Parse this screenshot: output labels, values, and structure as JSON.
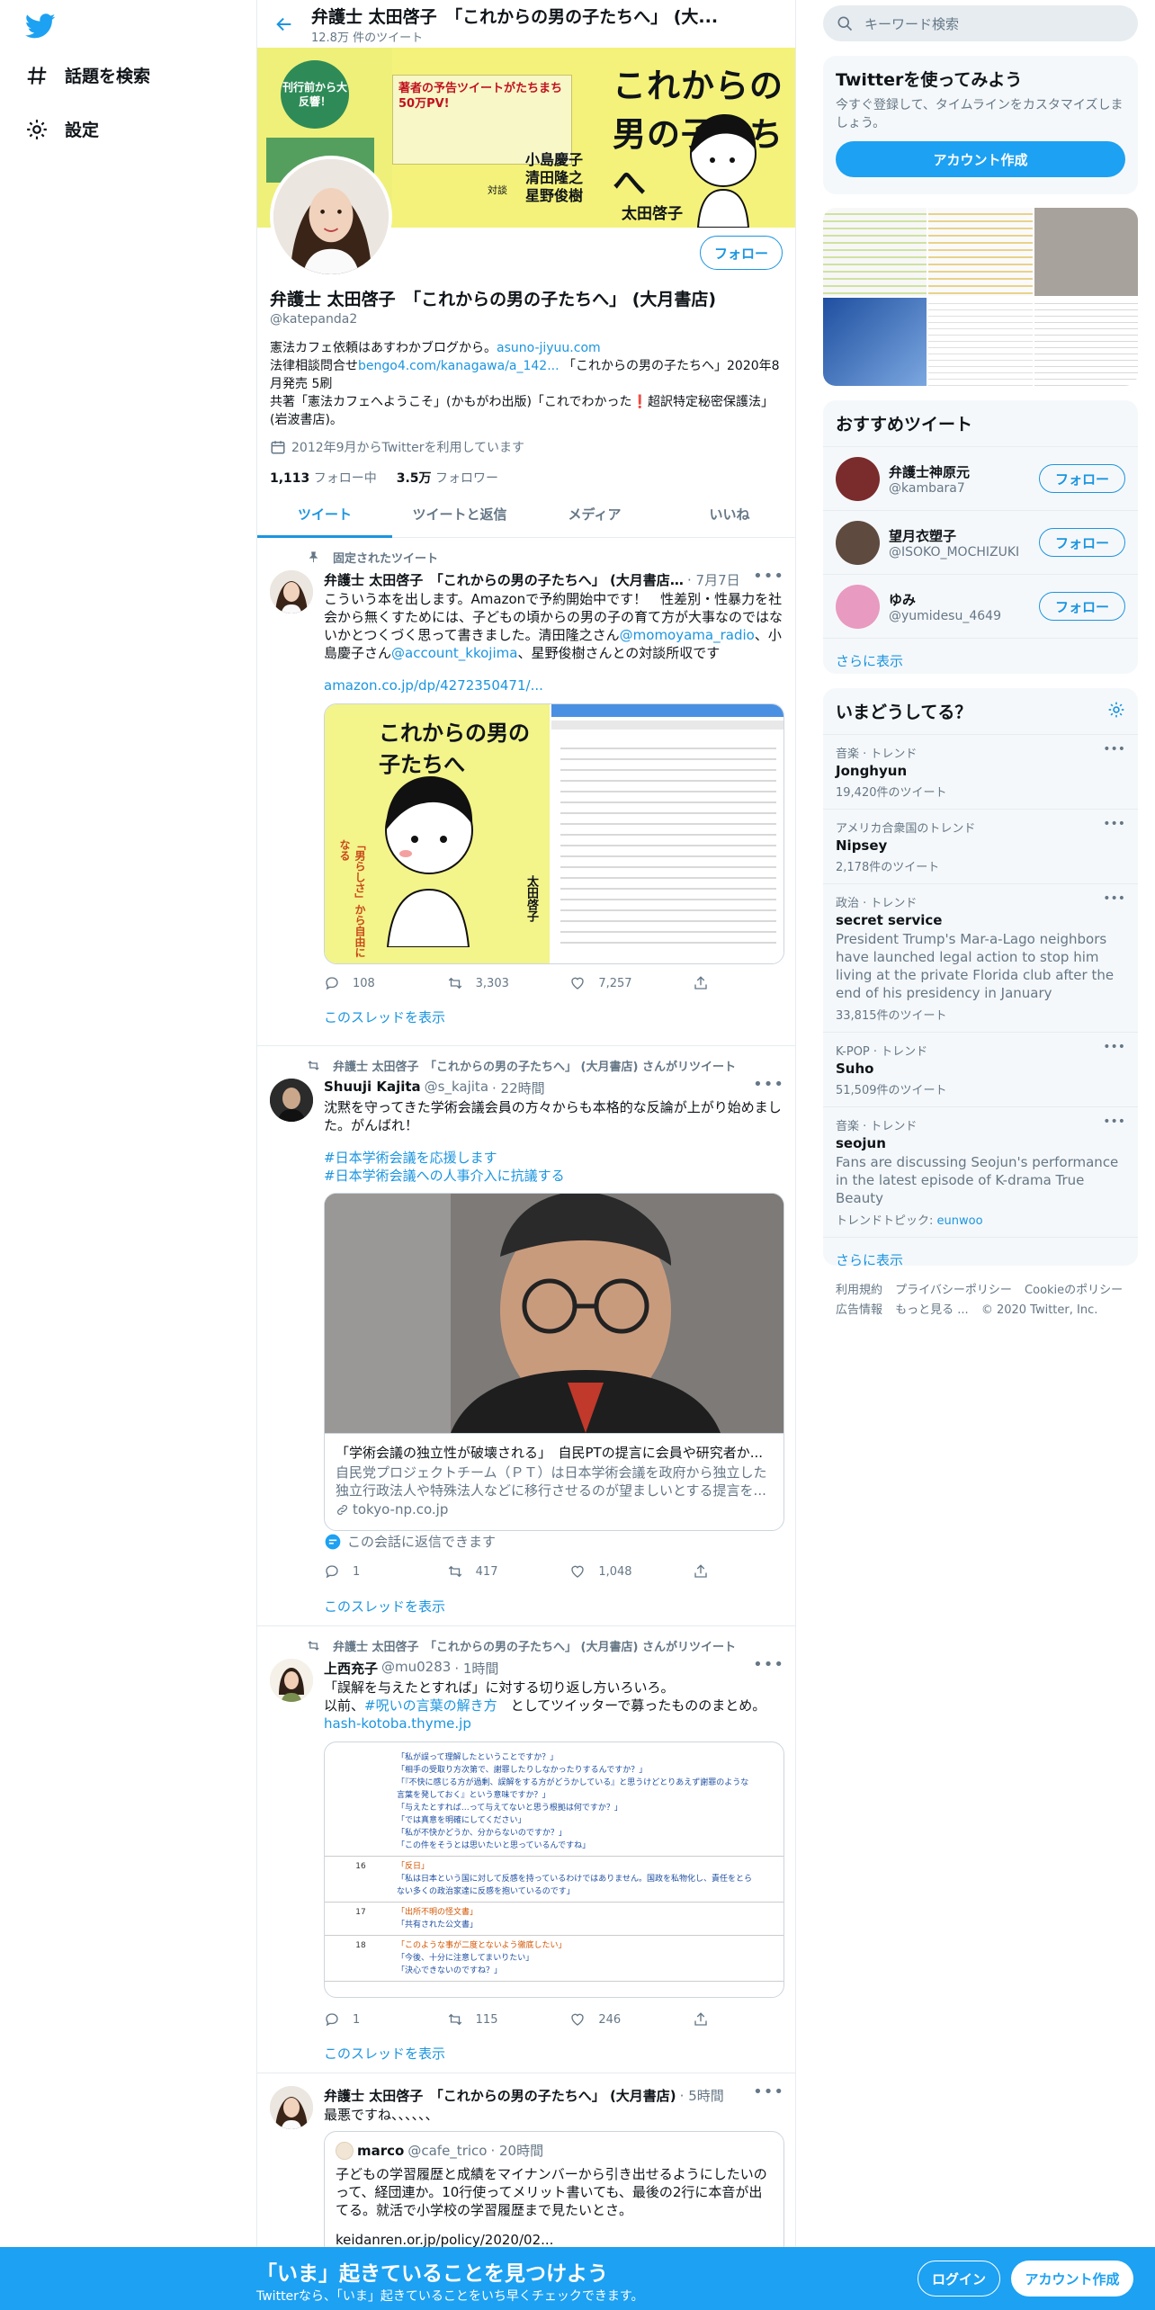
{
  "nav": {
    "explore_label": "話題を検索",
    "settings_label": "設定"
  },
  "header": {
    "name": "弁護士 太田啓子　「これからの男の子たちへ」 (大...",
    "tweet_count": "12.8万 件のツイート"
  },
  "banner": {
    "title": "これからの男の子たちへ",
    "badge": "刊行前から大反響！",
    "book_ad": "著者の予告ツイートがたちまち50万PV!",
    "author": "太田啓子",
    "guests": [
      "小島慶子",
      "清田隆之",
      "星野俊樹"
    ],
    "guests_label": "対談"
  },
  "profile": {
    "name": "弁護士 太田啓子　「これからの男の子たちへ」 (大月書店)",
    "handle": "@katepanda2",
    "follow_label": "フォロー",
    "bio_line1": "憲法カフェ依頼はあすわかブログから。",
    "bio_link1": "asuno-jiyuu.com",
    "bio_line2": "法律相談問合せ",
    "bio_link2": "bengo4.com/kanagawa/a_142...",
    "bio_line2b": " 「これからの男の子たちへ」2020年8月発売 5刷",
    "bio_line3": "共著「憲法カフェへようこそ」(かもがわ出版)「これでわかった",
    "bio_exclaim": "❗",
    "bio_line3b": "超訳特定秘密保護法」(岩波書店)。",
    "joined": "2012年9月からTwitterを利用しています",
    "following_count": "1,113",
    "following_label": "フォロー中",
    "followers_count": "3.5万",
    "followers_label": "フォロワー"
  },
  "tabs": [
    "ツイート",
    "ツイートと返信",
    "メディア",
    "いいね"
  ],
  "tweets": [
    {
      "meta": "固定されたツイート",
      "name": "弁護士 太田啓子　「これからの男の子たちへ」 (大月書店...",
      "time": "· 7月7日",
      "text_a": "こういう本を出します。Amazonで予約開始中です！　性差別・性暴力を社会から無くすためには、子どもの頃からの男の子の育て方が大事なのではないかとつくづく思って書きました。清田隆之さん",
      "mention1": "@momoyama_radio",
      "text_b": "、小島慶子さん",
      "mention2": "@account_kkojima",
      "text_c": "、星野俊樹さんとの対談所収です",
      "link": "amazon.co.jp/dp/4272350471/...",
      "cover_title": "これからの男の子たちへ",
      "cover_sub": "「男らしさ」から自由になる",
      "cover_author": "太田啓子",
      "replies": "108",
      "retweets": "3,303",
      "likes": "7,257",
      "show_thread": "このスレッドを表示"
    },
    {
      "meta": "弁護士 太田啓子　「これからの男の子たちへ」 (大月書店) さんがリツイート",
      "name": "Shuuji Kajita",
      "handle": "@s_kajita",
      "time": "· 22時間",
      "text": "沈黙を守ってきた学術会議会員の方々からも本格的な反論が上がり始めました。がんばれ！",
      "hashtag1": "#日本学術会議を応援します",
      "hashtag2": "#日本学術会議への人事介入に抗議する",
      "card_title": "「学術会議の独立性が破壊される」　自民PTの提言に会員や研究者か...",
      "card_desc": "自民党プロジェクトチーム（ＰＴ）は日本学術会議を政府から独立した独立行政法人や特殊法人などに移行させるのが望ましいとする提言を...",
      "card_domain": "tokyo-np.co.jp",
      "reply_note": "この会話に返信できます",
      "replies": "1",
      "retweets": "417",
      "likes": "1,048",
      "show_thread": "このスレッドを表示"
    },
    {
      "meta": "弁護士 太田啓子　「これからの男の子たちへ」 (大月書店) さんがリツイート",
      "name": "上西充子",
      "handle": "@mu0283",
      "time": "· 1時間",
      "text_a": "「誤解を与えたとすれば」に対する切り返し方いろいろ。",
      "text_b": "以前、",
      "hashtag": "#呪いの言葉の解き方",
      "text_c": "　としてツイッターで募ったもののまとめ。",
      "link": "hash-kotoba.thyme.jp",
      "replies": "1",
      "retweets": "115",
      "likes": "246",
      "show_thread": "このスレッドを表示"
    },
    {
      "name": "弁護士 太田啓子　「これからの男の子たちへ」 (大月書店)",
      "time": "· 5時間",
      "text": "最悪ですね、、、、、、",
      "quote_name": "marco",
      "quote_handle": "@cafe_trico",
      "quote_time": "· 20時間",
      "quote_text": "子どもの学習履歴と成績をマイナンバーから引き出せるようにしたいのって、経団連か。10行使ってメリット書いても、最後の2行に本音が出てる。就活で小学校の学習履歴まで見たいとさ。",
      "quote_link": "keidanren.or.jp/policy/2020/02..."
    }
  ],
  "screenshot_rows": [
    {
      "num": "",
      "lines": [
        "「私が誤って理解したということですか？」",
        "「相手の受取り方次第で、謝罪したりしなかったりするんですか？」",
        "「『不快に感じる方が過剰、誤解をする方がどうかしている』と思うけどとりあえず謝罪のような言葉を発しておく』という意味ですか？」",
        "「与えたとすれば…って与えてないと思う根拠は何ですか？」",
        "「では真意を明確にしてください」",
        "「私が不快かどうか、分からないのですか？」",
        "「この件をそうとは思いたいと思っているんですね」"
      ]
    },
    {
      "num": "16",
      "lines": [
        "「反日」",
        "「私は日本という国に対して反感を持っているわけではありません。国政を私物化し、責任をとらない多くの政治家達に反感を抱いているのです」"
      ]
    },
    {
      "num": "17",
      "lines": [
        "「出所不明の怪文書」",
        "「共有された公文書」"
      ]
    },
    {
      "num": "18",
      "lines": [
        "「このような事が二度とないよう徹底したい」",
        "「今後、十分に注意してまいりたい」",
        "「決心できないのですね？」"
      ]
    }
  ],
  "right": {
    "search_placeholder": "キーワード検索",
    "signup_title": "Twitterを使ってみよう",
    "signup_desc": "今すぐ登録して、タイムラインをカスタマイズしましょう。",
    "signup_button": "アカウント作成",
    "recommend_title": "おすすめツイート",
    "recommends": [
      {
        "name": "弁護士神原元",
        "handle": "@kambara7",
        "button": "フォロー"
      },
      {
        "name": "望月衣塑子",
        "handle": "@ISOKO_MOCHIZUKI",
        "button": "フォロー"
      },
      {
        "name": "ゆみ",
        "handle": "@yumidesu_4649",
        "button": "フォロー"
      }
    ],
    "show_more": "さらに表示",
    "trends_title": "いまどうしてる？",
    "trends": [
      {
        "context": "音楽 · トレンド",
        "title": "Jonghyun",
        "desc": "",
        "count": "19,420件のツイート"
      },
      {
        "context": "アメリカ合衆国のトレンド",
        "title": "Nipsey",
        "desc": "",
        "count": "2,178件のツイート"
      },
      {
        "context": "政治 · トレンド",
        "title": "secret service",
        "desc": "President Trump's Mar-a-Lago neighbors have launched legal action to stop him living at the private Florida club after the end of his presidency in January",
        "count": "33,815件のツイート"
      },
      {
        "context": "K-POP · トレンド",
        "title": "Suho",
        "desc": "",
        "count": "51,509件のツイート"
      },
      {
        "context": "音楽 · トレンド",
        "title": "seojun",
        "desc": "Fans are discussing Seojun's performance in the latest episode of K-drama True Beauty",
        "count": "トレンドトピック: ",
        "topic": "eunwoo"
      }
    ],
    "trends_more": "さらに表示",
    "footer": [
      "利用規約",
      "プライバシーポリシー",
      "Cookieのポリシー",
      "広告情報",
      "もっと見る ...",
      "© 2020 Twitter, Inc."
    ]
  },
  "bottombar": {
    "title": "「いま」起きていることを見つけよう",
    "subtitle": "Twitterなら、「いま」起きていることをいち早くチェックできます。",
    "login": "ログイン",
    "signup": "アカウント作成"
  },
  "colors": {
    "accent": "#1b95e0",
    "brand": "#1da1f2"
  }
}
